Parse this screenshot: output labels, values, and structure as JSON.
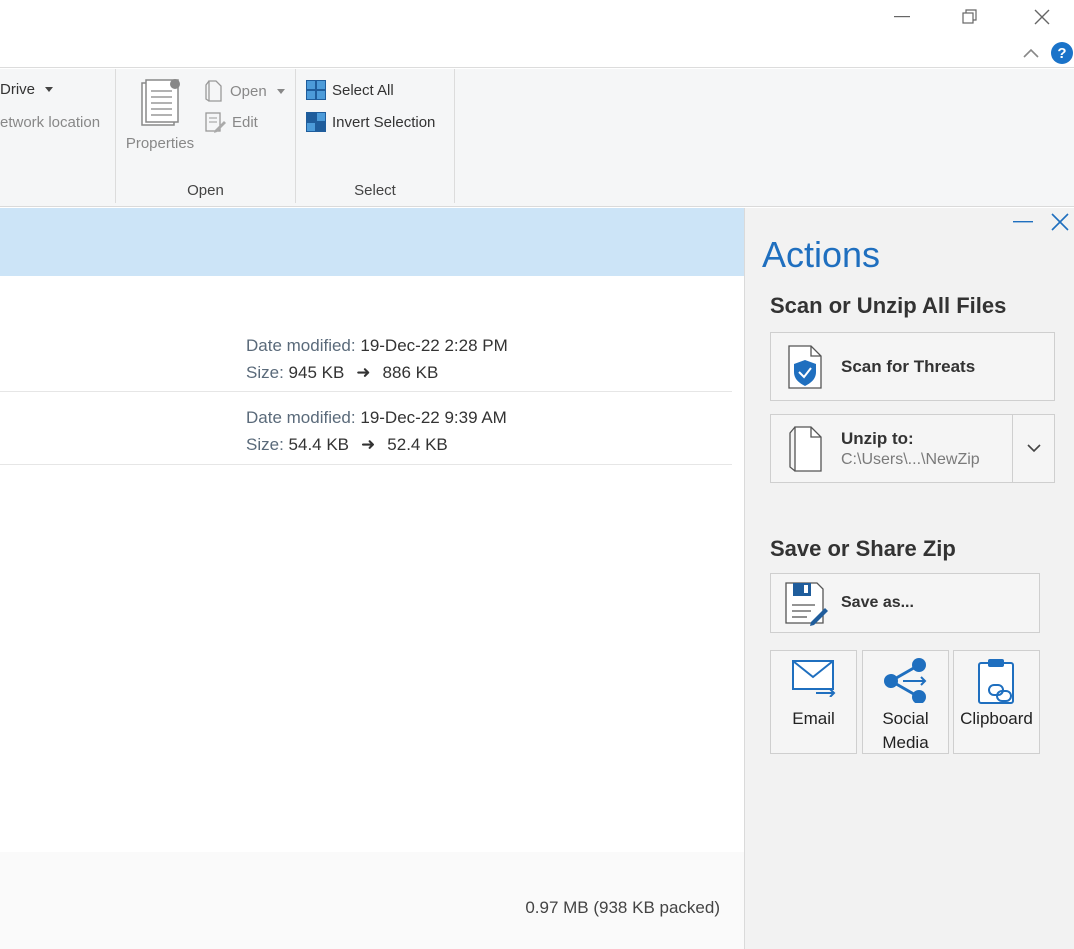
{
  "ribbon": {
    "drive_label": "Drive",
    "network_label": "etwork location",
    "properties_label": "Properties",
    "open_label": "Open",
    "edit_label": "Edit",
    "open_group_label": "Open",
    "select_all_label": "Select All",
    "invert_selection_label": "Invert Selection",
    "select_group_label": "Select"
  },
  "files": [
    {
      "date_key": "Date modified:",
      "date_value": "19-Dec-22 2:28 PM",
      "size_key": "Size:",
      "size_original": "945 KB",
      "size_packed": "886 KB"
    },
    {
      "date_key": "Date modified:",
      "date_value": "19-Dec-22 9:39 AM",
      "size_key": "Size:",
      "size_original": "54.4 KB",
      "size_packed": "52.4 KB"
    }
  ],
  "status": {
    "summary": "0.97 MB (938 KB packed)"
  },
  "actions": {
    "title": "Actions",
    "section_scan": "Scan or Unzip All Files",
    "scan_label": "Scan for Threats",
    "unzip_label": "Unzip to:",
    "unzip_path": "C:\\Users\\...\\NewZip",
    "section_save": "Save or Share Zip",
    "save_as_label": "Save as...",
    "email_label": "Email",
    "social_label": "Social Media",
    "clipboard_label": "Clipboard"
  },
  "colors": {
    "accent": "#1f6fbf",
    "selection": "#cce4f7",
    "icon_blue": "#1f5d9c"
  }
}
